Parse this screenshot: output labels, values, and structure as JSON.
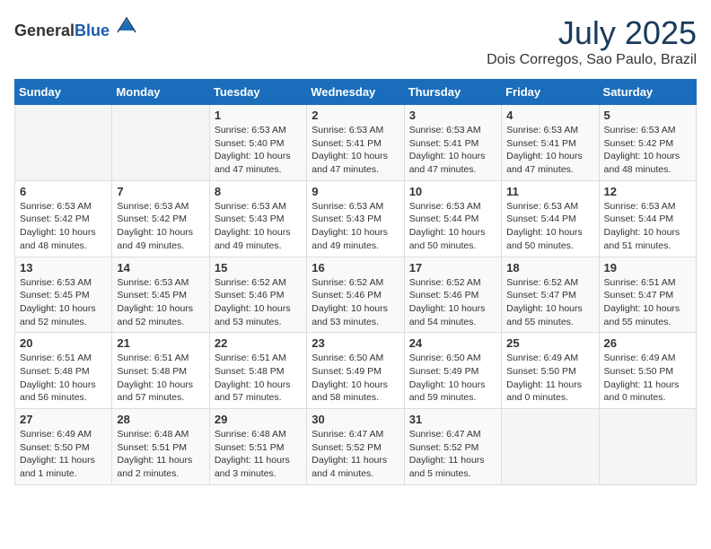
{
  "header": {
    "logo_general": "General",
    "logo_blue": "Blue",
    "month_title": "July 2025",
    "location": "Dois Corregos, Sao Paulo, Brazil"
  },
  "weekdays": [
    "Sunday",
    "Monday",
    "Tuesday",
    "Wednesday",
    "Thursday",
    "Friday",
    "Saturday"
  ],
  "weeks": [
    [
      {
        "day": "",
        "info": ""
      },
      {
        "day": "",
        "info": ""
      },
      {
        "day": "1",
        "info": "Sunrise: 6:53 AM\nSunset: 5:40 PM\nDaylight: 10 hours and 47 minutes."
      },
      {
        "day": "2",
        "info": "Sunrise: 6:53 AM\nSunset: 5:41 PM\nDaylight: 10 hours and 47 minutes."
      },
      {
        "day": "3",
        "info": "Sunrise: 6:53 AM\nSunset: 5:41 PM\nDaylight: 10 hours and 47 minutes."
      },
      {
        "day": "4",
        "info": "Sunrise: 6:53 AM\nSunset: 5:41 PM\nDaylight: 10 hours and 47 minutes."
      },
      {
        "day": "5",
        "info": "Sunrise: 6:53 AM\nSunset: 5:42 PM\nDaylight: 10 hours and 48 minutes."
      }
    ],
    [
      {
        "day": "6",
        "info": "Sunrise: 6:53 AM\nSunset: 5:42 PM\nDaylight: 10 hours and 48 minutes."
      },
      {
        "day": "7",
        "info": "Sunrise: 6:53 AM\nSunset: 5:42 PM\nDaylight: 10 hours and 49 minutes."
      },
      {
        "day": "8",
        "info": "Sunrise: 6:53 AM\nSunset: 5:43 PM\nDaylight: 10 hours and 49 minutes."
      },
      {
        "day": "9",
        "info": "Sunrise: 6:53 AM\nSunset: 5:43 PM\nDaylight: 10 hours and 49 minutes."
      },
      {
        "day": "10",
        "info": "Sunrise: 6:53 AM\nSunset: 5:44 PM\nDaylight: 10 hours and 50 minutes."
      },
      {
        "day": "11",
        "info": "Sunrise: 6:53 AM\nSunset: 5:44 PM\nDaylight: 10 hours and 50 minutes."
      },
      {
        "day": "12",
        "info": "Sunrise: 6:53 AM\nSunset: 5:44 PM\nDaylight: 10 hours and 51 minutes."
      }
    ],
    [
      {
        "day": "13",
        "info": "Sunrise: 6:53 AM\nSunset: 5:45 PM\nDaylight: 10 hours and 52 minutes."
      },
      {
        "day": "14",
        "info": "Sunrise: 6:53 AM\nSunset: 5:45 PM\nDaylight: 10 hours and 52 minutes."
      },
      {
        "day": "15",
        "info": "Sunrise: 6:52 AM\nSunset: 5:46 PM\nDaylight: 10 hours and 53 minutes."
      },
      {
        "day": "16",
        "info": "Sunrise: 6:52 AM\nSunset: 5:46 PM\nDaylight: 10 hours and 53 minutes."
      },
      {
        "day": "17",
        "info": "Sunrise: 6:52 AM\nSunset: 5:46 PM\nDaylight: 10 hours and 54 minutes."
      },
      {
        "day": "18",
        "info": "Sunrise: 6:52 AM\nSunset: 5:47 PM\nDaylight: 10 hours and 55 minutes."
      },
      {
        "day": "19",
        "info": "Sunrise: 6:51 AM\nSunset: 5:47 PM\nDaylight: 10 hours and 55 minutes."
      }
    ],
    [
      {
        "day": "20",
        "info": "Sunrise: 6:51 AM\nSunset: 5:48 PM\nDaylight: 10 hours and 56 minutes."
      },
      {
        "day": "21",
        "info": "Sunrise: 6:51 AM\nSunset: 5:48 PM\nDaylight: 10 hours and 57 minutes."
      },
      {
        "day": "22",
        "info": "Sunrise: 6:51 AM\nSunset: 5:48 PM\nDaylight: 10 hours and 57 minutes."
      },
      {
        "day": "23",
        "info": "Sunrise: 6:50 AM\nSunset: 5:49 PM\nDaylight: 10 hours and 58 minutes."
      },
      {
        "day": "24",
        "info": "Sunrise: 6:50 AM\nSunset: 5:49 PM\nDaylight: 10 hours and 59 minutes."
      },
      {
        "day": "25",
        "info": "Sunrise: 6:49 AM\nSunset: 5:50 PM\nDaylight: 11 hours and 0 minutes."
      },
      {
        "day": "26",
        "info": "Sunrise: 6:49 AM\nSunset: 5:50 PM\nDaylight: 11 hours and 0 minutes."
      }
    ],
    [
      {
        "day": "27",
        "info": "Sunrise: 6:49 AM\nSunset: 5:50 PM\nDaylight: 11 hours and 1 minute."
      },
      {
        "day": "28",
        "info": "Sunrise: 6:48 AM\nSunset: 5:51 PM\nDaylight: 11 hours and 2 minutes."
      },
      {
        "day": "29",
        "info": "Sunrise: 6:48 AM\nSunset: 5:51 PM\nDaylight: 11 hours and 3 minutes."
      },
      {
        "day": "30",
        "info": "Sunrise: 6:47 AM\nSunset: 5:52 PM\nDaylight: 11 hours and 4 minutes."
      },
      {
        "day": "31",
        "info": "Sunrise: 6:47 AM\nSunset: 5:52 PM\nDaylight: 11 hours and 5 minutes."
      },
      {
        "day": "",
        "info": ""
      },
      {
        "day": "",
        "info": ""
      }
    ]
  ]
}
